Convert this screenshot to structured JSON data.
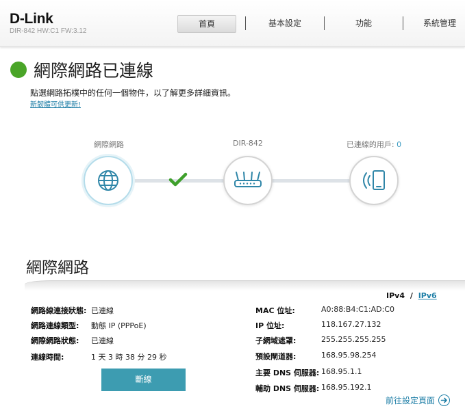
{
  "header": {
    "logo": "D-Link",
    "model": "DIR-842 HW:C1 FW:3.12",
    "nav": [
      "首頁",
      "基本設定",
      "功能",
      "系統管理"
    ]
  },
  "status": {
    "title": "網際網路已連線",
    "hint": "點選網路拓樸中的任何一個物件，以了解更多詳細資訊。",
    "firmware_link": "新韌體可供更新!",
    "color": "#4aa528"
  },
  "topology": {
    "internet_label": "網際網路",
    "router_label": "DIR-842",
    "clients_label": "已連線的用戶:",
    "clients_count": "0"
  },
  "internet": {
    "title": "網際網路",
    "ipv4": "IPv4",
    "separator": "/",
    "ipv6": "IPv6",
    "left": [
      {
        "label": "網路線連接狀態:",
        "value": "已連線"
      },
      {
        "label": "網路連線類型:",
        "value": "動態 IP (PPPoE)"
      },
      {
        "label": "網際網路狀態:",
        "value": "已連線"
      },
      {
        "label": "連線時間:",
        "value": "1 天 3 時 38 分 29 秒"
      }
    ],
    "right": [
      {
        "label": "MAC 位址:",
        "value": "A0:88:B4:C1:AD:C0"
      },
      {
        "label": "IP 位址:",
        "value": "118.167.27.132"
      },
      {
        "label": "子網域遮罩:",
        "value": "255.255.255.255"
      },
      {
        "label": "預設閘道器:",
        "value": "168.95.98.254"
      },
      {
        "label": "主要 DNS 伺服器:",
        "value": "168.95.1.1"
      },
      {
        "label": "輔助 DNS 伺服器:",
        "value": "168.95.192.1"
      }
    ],
    "disconnect": "斷線",
    "settings_link": "前往設定頁面"
  },
  "colors": {
    "accent": "#3d9cb1",
    "link": "#1f7fa7",
    "connected": "#4aa528"
  }
}
